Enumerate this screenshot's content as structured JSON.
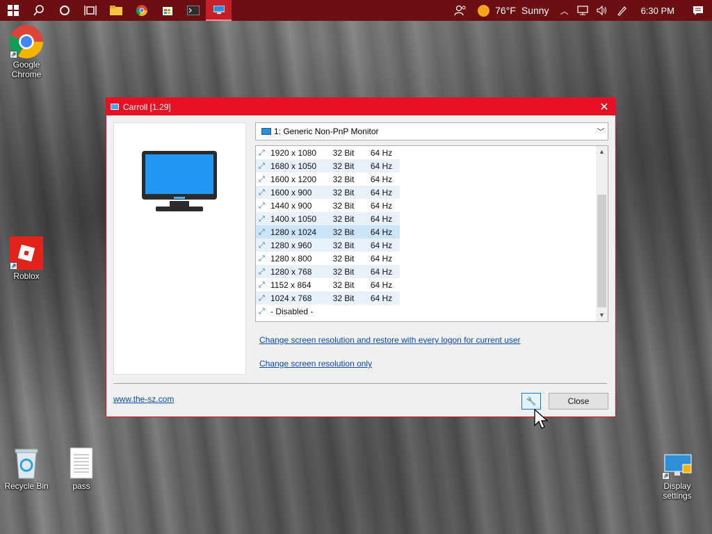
{
  "taskbar": {
    "weather_temp": "76°F",
    "weather_condition": "Sunny",
    "time": "6:30 PM"
  },
  "desktop_icons": {
    "chrome": "Google Chrome",
    "roblox": "Roblox",
    "recycle_bin": "Recycle Bin",
    "pass": "pass",
    "display_settings": "Display settings"
  },
  "window": {
    "title": "Carroll [1.29]",
    "monitor_dropdown": "1: Generic Non-PnP Monitor",
    "resolutions": [
      {
        "res": "1920 x 1080",
        "bits": "32 Bit",
        "hz": "64 Hz"
      },
      {
        "res": "1680 x 1050",
        "bits": "32 Bit",
        "hz": "64 Hz"
      },
      {
        "res": "1600 x 1200",
        "bits": "32 Bit",
        "hz": "64 Hz"
      },
      {
        "res": "1600 x 900",
        "bits": "32 Bit",
        "hz": "64 Hz"
      },
      {
        "res": "1440 x 900",
        "bits": "32 Bit",
        "hz": "64 Hz"
      },
      {
        "res": "1400 x 1050",
        "bits": "32 Bit",
        "hz": "64 Hz"
      },
      {
        "res": "1280 x 1024",
        "bits": "32 Bit",
        "hz": "64 Hz"
      },
      {
        "res": "1280 x 960",
        "bits": "32 Bit",
        "hz": "64 Hz"
      },
      {
        "res": "1280 x 800",
        "bits": "32 Bit",
        "hz": "64 Hz"
      },
      {
        "res": "1280 x 768",
        "bits": "32 Bit",
        "hz": "64 Hz"
      },
      {
        "res": "1152 x 864",
        "bits": "32 Bit",
        "hz": "64 Hz"
      },
      {
        "res": "1024 x 768",
        "bits": "32 Bit",
        "hz": "64 Hz"
      },
      {
        "res": "- Disabled -",
        "bits": "",
        "hz": ""
      }
    ],
    "selected_resolution": "1280 x 1024",
    "link_restore": "Change screen resolution and restore with every logon for current user",
    "link_only": "Change screen resolution only",
    "website": "www.the-sz.com",
    "close_label": "Close"
  }
}
